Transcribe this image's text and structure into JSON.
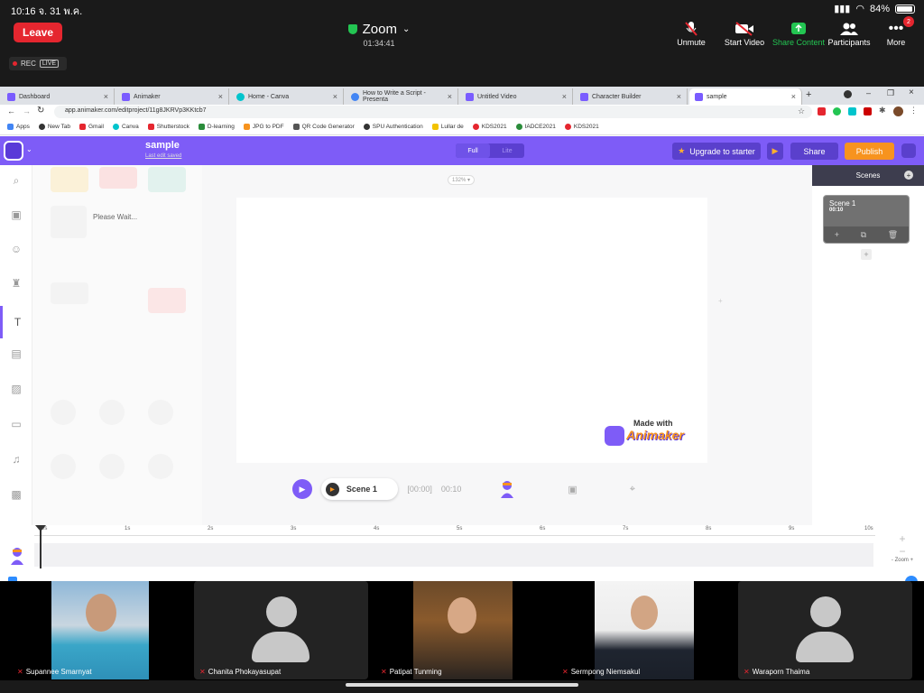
{
  "status": {
    "time": "10:16",
    "date": "จ. 31 พ.ค.",
    "battery": "84%"
  },
  "zoom": {
    "leave_label": "Leave",
    "title": "Zoom",
    "duration": "01:34:41",
    "buttons": [
      {
        "label": "Unmute",
        "icon": "mic-off-icon"
      },
      {
        "label": "Start Video",
        "icon": "video-off-icon"
      },
      {
        "label": "Share Content",
        "icon": "share-screen-icon"
      },
      {
        "label": "Participants",
        "icon": "participants-icon"
      },
      {
        "label": "More",
        "icon": "more-icon"
      }
    ],
    "more_badge": "2",
    "rec": "REC",
    "live": "LIVE"
  },
  "browser": {
    "tabs": [
      "Dashboard",
      "Animaker",
      "Home - Canva",
      "How to Write a Script - Presenta",
      "Untitled Video",
      "Character Builder",
      "sample"
    ],
    "url": "app.animaker.com/editproject/11g8JKRVp3KKtcb7",
    "bookmarks": [
      "Apps",
      "New Tab",
      "Gmail",
      "Canva",
      "Shutterstock",
      "D-learning",
      "JPG to PDF",
      "QR Code Generator",
      "SPU Authentication",
      "Lullar de",
      "KDS2021",
      "IADCE2021",
      "KDS2021"
    ]
  },
  "animaker": {
    "project_name": "sample",
    "last_saved": "Last edit saved",
    "mode_full": "Full",
    "mode_lite": "Lite",
    "upgrade_label": "Upgrade to starter",
    "share_label": "Share",
    "publish_label": "Publish",
    "panel_status": "Please Wait...",
    "zoom_percent": "132% ▾",
    "watermark_top": "Made with",
    "watermark_brand": "Animaker",
    "scene_label": "Scene 1",
    "time_current": "[00:00]",
    "time_total": "00:10",
    "scenes_title": "Scenes",
    "scene_card_name": "Scene 1",
    "scene_card_duration": "00:10",
    "ruler_ticks": [
      "0s",
      "1s",
      "2s",
      "3s",
      "4s",
      "5s",
      "6s",
      "7s",
      "8s",
      "9s",
      "10s"
    ],
    "zoom_label": "Zoom"
  },
  "participants": [
    {
      "name": "Supannee Smarnyat",
      "video": true
    },
    {
      "name": "Chanita Phokayasupat",
      "video": false
    },
    {
      "name": "Patipat Tunming",
      "video": true
    },
    {
      "name": "Sermpong Niemsakul",
      "video": true
    },
    {
      "name": "Waraporn Thaima",
      "video": false
    }
  ],
  "colors": {
    "accent": "#7e5cf7",
    "publish": "#f7931e",
    "leave": "#e5262f",
    "zoom_blue": "#2d8cff",
    "share_green": "#23c552"
  }
}
